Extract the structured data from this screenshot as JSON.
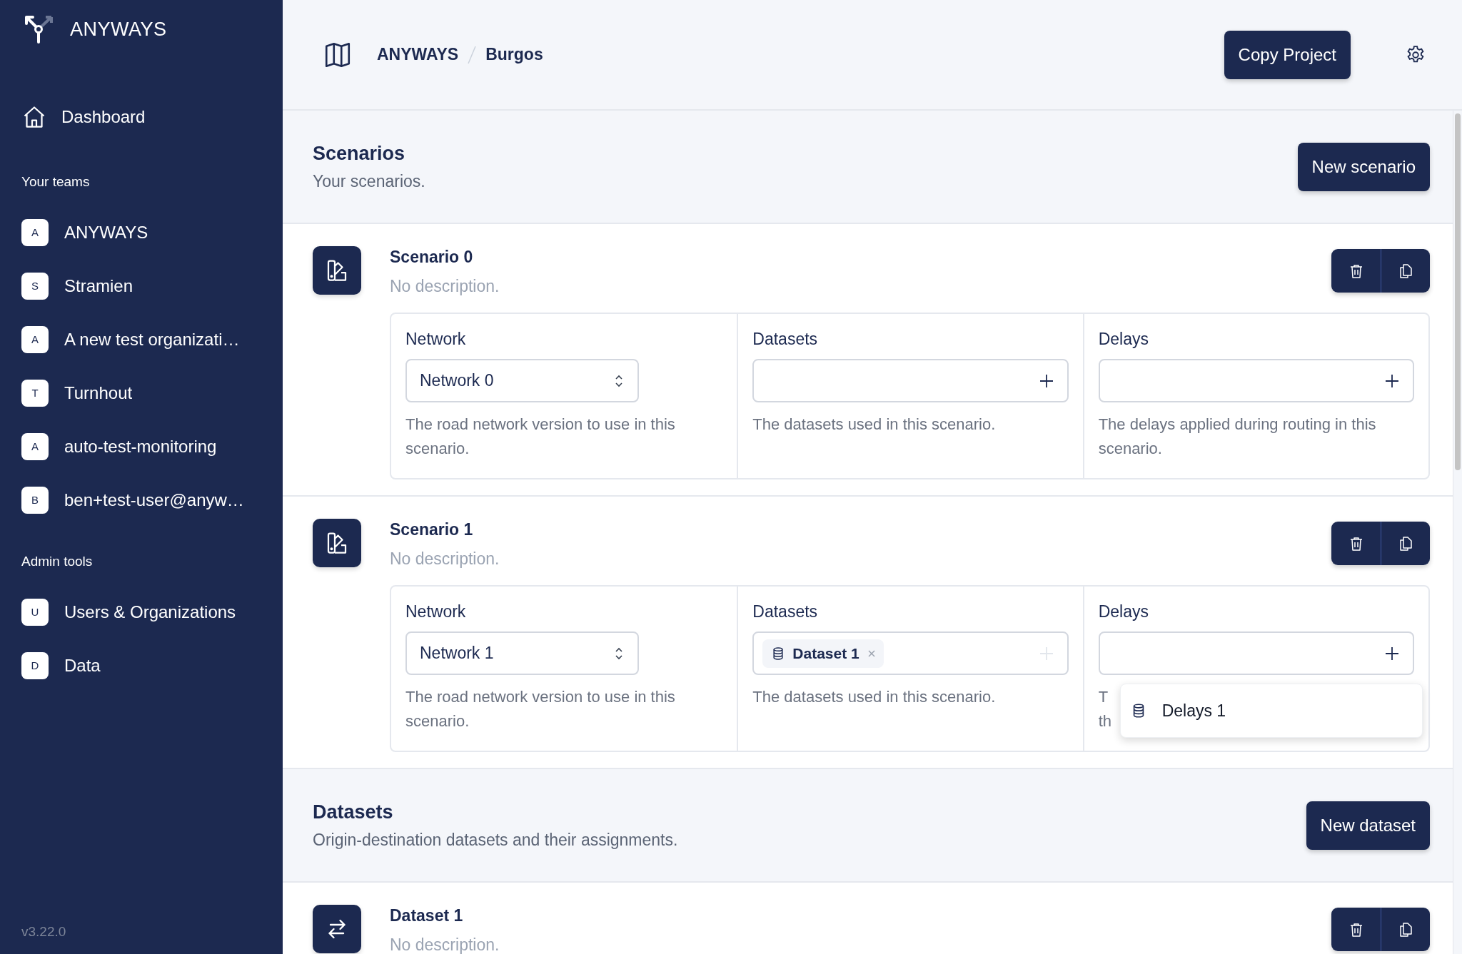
{
  "sidebar": {
    "brand": "ANYWAYS",
    "nav": [
      {
        "label": "Dashboard"
      }
    ],
    "teams_heading": "Your teams",
    "teams": [
      {
        "initial": "A",
        "name": "ANYWAYS"
      },
      {
        "initial": "S",
        "name": "Stramien"
      },
      {
        "initial": "A",
        "name": "A new test organizati…"
      },
      {
        "initial": "T",
        "name": "Turnhout"
      },
      {
        "initial": "A",
        "name": "auto-test-monitoring"
      },
      {
        "initial": "B",
        "name": "ben+test-user@anyw…"
      }
    ],
    "admin_heading": "Admin tools",
    "admin": [
      {
        "initial": "U",
        "name": "Users & Organizations"
      },
      {
        "initial": "D",
        "name": "Data"
      }
    ],
    "version": "v3.22.0"
  },
  "header": {
    "breadcrumb": [
      "ANYWAYS",
      "Burgos"
    ],
    "copy_button": "Copy Project"
  },
  "scenarios": {
    "title": "Scenarios",
    "subtitle": "Your scenarios.",
    "new_button": "New scenario",
    "items": [
      {
        "name": "Scenario 0",
        "description": "No description.",
        "fields": [
          {
            "kind": "select",
            "label": "Network",
            "value": "Network 0",
            "help": "The road network version to use in this scenario."
          },
          {
            "kind": "multi",
            "label": "Datasets",
            "add_disabled": false,
            "help": "The datasets used in this scenario."
          },
          {
            "kind": "multi",
            "label": "Delays",
            "add_disabled": false,
            "help": "The delays applied during routing in this scenario."
          }
        ]
      },
      {
        "name": "Scenario 1",
        "description": "No description.",
        "fields": [
          {
            "kind": "select",
            "label": "Network",
            "value": "Network 1",
            "help": "The road network version to use in this scenario."
          },
          {
            "kind": "multi",
            "label": "Datasets",
            "tags": [
              "Dataset 1"
            ],
            "add_disabled": true,
            "help": "The datasets used in this scenario."
          },
          {
            "kind": "multi",
            "label": "Delays",
            "add_disabled": false,
            "help_lines": [
              "T",
              "th"
            ],
            "dropdown": [
              "Delays 1"
            ]
          }
        ]
      }
    ]
  },
  "datasets": {
    "title": "Datasets",
    "subtitle": "Origin-destination datasets and their assignments.",
    "new_button": "New dataset",
    "items": [
      {
        "name": "Dataset 1",
        "description": "No description."
      }
    ]
  }
}
